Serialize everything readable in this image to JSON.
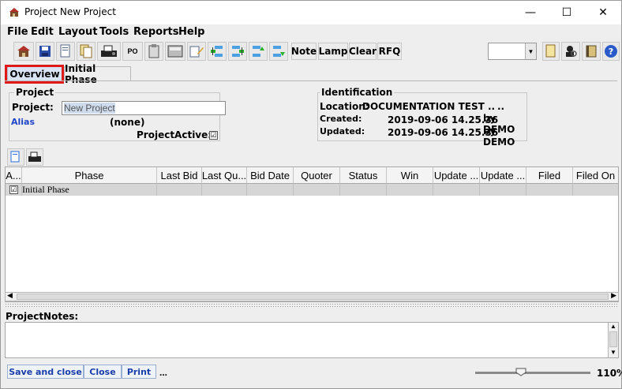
{
  "window": {
    "title": "Project New Project",
    "minimize": "—",
    "maximize": "☐",
    "close": "✕"
  },
  "menu": [
    "File",
    "Edit",
    "Layout",
    "Tools",
    "Reports",
    "Help"
  ],
  "toolbar": {
    "note": "Note",
    "lamp": "Lamp",
    "clear": "Clear",
    "rfq": "RFQ",
    "po": "PO",
    "combo_value": ""
  },
  "tabs": [
    "Overview",
    "Initial Phase"
  ],
  "project_group": {
    "legend": "Project",
    "project_label": "Project:",
    "project_value": "New Project",
    "alias_label": "Alias",
    "alias_value": "(none)",
    "active_label": "ProjectActive:",
    "active_checked": "☑"
  },
  "identification": {
    "legend": "Identification",
    "location_label": "Location:",
    "location_value": "DOCUMENTATION TEST ..",
    "location_extra": "..",
    "created_label": "Created:",
    "created_value": "2019-09-06 14.25.36",
    "created_by": "by DEMO",
    "updated_label": "Updated:",
    "updated_value": "2019-09-06 14.25.36",
    "updated_by": "by DEMO"
  },
  "grid": {
    "columns": [
      "A...",
      "Phase",
      "Last Bid",
      "Last Qu...",
      "Bid Date",
      "Quoter",
      "Status",
      "Win",
      "Update ...",
      "Update ...",
      "Filed",
      "Filed On"
    ],
    "rows": [
      {
        "check": "☑",
        "phase": "Initial Phase"
      }
    ]
  },
  "notes": {
    "label": "ProjectNotes:",
    "value": ""
  },
  "bottom": {
    "save_close": "Save and close",
    "close": "Close",
    "print": "Print",
    "ellipsis": "...",
    "zoom": "110%"
  },
  "colors": {
    "highlight": "#e01818",
    "link_blue": "#1a3ea8",
    "alias_blue": "#1f45c8"
  }
}
